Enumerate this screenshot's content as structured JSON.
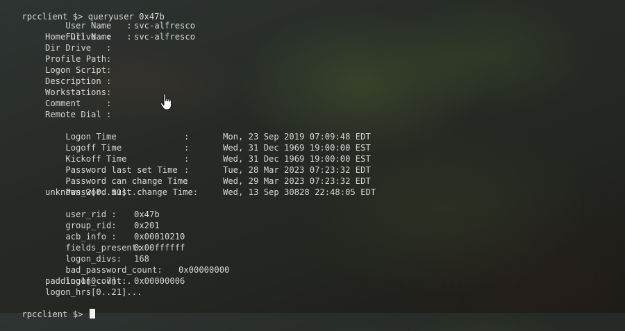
{
  "terminal": {
    "prompt": "rpcclient $>",
    "command": "queryuser 0x47b",
    "fields": {
      "user_name": {
        "label": "User Name   :",
        "value": "svc-alfresco"
      },
      "full_name": {
        "label": "Full Name   :",
        "value": "svc-alfresco"
      },
      "home_drive": {
        "label": "Home Drive  :",
        "value": ""
      },
      "dir_drive": {
        "label": "Dir Drive   :",
        "value": ""
      },
      "profile_path": {
        "label": "Profile Path:",
        "value": ""
      },
      "logon_script": {
        "label": "Logon Script:",
        "value": ""
      },
      "description": {
        "label": "Description :",
        "value": ""
      },
      "workstations": {
        "label": "Workstations:",
        "value": ""
      },
      "comment": {
        "label": "Comment     :",
        "value": ""
      },
      "remote_dial": {
        "label": "Remote Dial :",
        "value": ""
      }
    },
    "times": {
      "logon_time": {
        "label": "Logon Time",
        "value": "Mon, 23 Sep 2019 07:09:48 EDT"
      },
      "logoff_time": {
        "label": "Logoff Time",
        "value": "Wed, 31 Dec 1969 19:00:00 EST"
      },
      "kickoff_time": {
        "label": "Kickoff Time",
        "value": "Wed, 31 Dec 1969 19:00:00 EST"
      },
      "pwd_last_set": {
        "label": "Password last set Time",
        "value": "Tue, 28 Mar 2023 07:23:32 EDT"
      },
      "pwd_can_change": {
        "label": "Password can change Time",
        "value": "Wed, 29 Mar 2023 07:23:32 EDT"
      },
      "pwd_must_change": {
        "label": "Password must change Time:",
        "value": "Wed, 13 Sep 30828 22:48:05 EDT"
      }
    },
    "colon": ":",
    "misc": {
      "unknown_2": "unknown_2[0..31]...",
      "user_rid": {
        "label": "user_rid :",
        "value": "0x47b"
      },
      "group_rid": {
        "label": "group_rid:",
        "value": "0x201"
      },
      "acb_info": {
        "label": "acb_info :",
        "value": "0x00010210"
      },
      "fields_present": {
        "label": "fields_present:",
        "value": "0x00ffffff"
      },
      "logon_divs": {
        "label": "logon_divs:",
        "value": "168"
      },
      "bad_password_count": {
        "label": "bad_password_count:",
        "value": "0x00000000"
      },
      "logon_count": {
        "label": "logon_count:",
        "value": "0x00000006"
      },
      "padding1": "padding1[0..7]...",
      "logon_hrs": "logon_hrs[0..21]..."
    }
  },
  "pointer_icon": "hand-pointer-icon"
}
